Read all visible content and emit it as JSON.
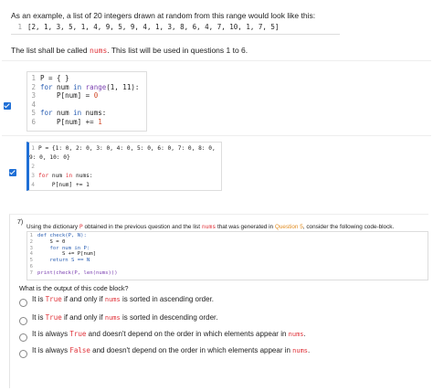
{
  "intro": "As an example, a list of 20 integers drawn at random from this range would look like this:",
  "example_line_no": "1",
  "example_list": "[2, 1, 3, 5, 1, 4, 9, 5, 9, 4, 1, 3, 8, 6, 4, 7, 10, 1, 7, 5]",
  "nums_sentence": {
    "pre": "The list shall be called ",
    "var": "nums",
    "post": ". This list will be used in questions 1 to 6."
  },
  "code1": {
    "line_numbers": [
      "1",
      "2",
      "3",
      "4",
      "5",
      "6"
    ],
    "l1": {
      "a": "P = { }"
    },
    "l2": {
      "for": "for",
      "num": " num ",
      "in": "in",
      "range": " range",
      "args": "(1, 11):"
    },
    "l3": {
      "text": "    P[num] = ",
      "val": "0"
    },
    "l4": {
      "text": ""
    },
    "l5": {
      "for": "for",
      "rest": " num ",
      "in": "in",
      "tail": " nums:"
    },
    "l6": {
      "text": "    P[num] += ",
      "val": "1"
    }
  },
  "code2": {
    "line_numbers": [
      "1",
      "2",
      "3",
      "4"
    ],
    "l1": "P = {1: 0, 2: 0, 3: 0, 4: 0, 5: 0, 6: 0, 7: 0, 8: 0, 9: 0, 10: 0}",
    "l3": {
      "for": "for",
      "rest": " num ",
      "in": "in",
      "tail": " nums:"
    },
    "l4": "    P[num] += 1"
  },
  "question7": {
    "number": "7)",
    "text_pre": "Using the dictionary ",
    "var_p": "P",
    "text_mid": " obtained in the previous question and the list ",
    "var_nums": "nums",
    "text_mid2": " that was generated in ",
    "link": "Question 5",
    "text_post": ", consider the following code-block.",
    "code": {
      "line_numbers": [
        "1",
        "2",
        "3",
        "4",
        "5",
        "6",
        "7"
      ],
      "l1": "def check(P, N):",
      "l2": "    S = 0",
      "l3": "    for num in P:",
      "l4": "        S += P[num]",
      "l5": "    return S == N",
      "l6": "",
      "l7": "print(check(P, len(nums)))"
    },
    "prompt": "What is the output of this code block?",
    "options": [
      {
        "pre": "It is ",
        "kw": "True",
        "post": " if and only if ",
        "var": "nums",
        "end": " is sorted in ascending order."
      },
      {
        "pre": "It is ",
        "kw": "True",
        "post": " if and only if ",
        "var": "nums",
        "end": " is sorted in descending order."
      },
      {
        "pre": "It is always ",
        "kw": "True",
        "post": " and doesn't depend on the order in which elements appear in ",
        "var": "nums",
        "end": "."
      },
      {
        "pre": "It is always ",
        "kw": "False",
        "post": " and doesn't depend on the order in which elements appear in ",
        "var": "nums",
        "end": "."
      }
    ]
  },
  "colors": {
    "accent": "#1f6fd6",
    "keyword_red": "#e0333a",
    "link_orange": "#e08a1e"
  }
}
